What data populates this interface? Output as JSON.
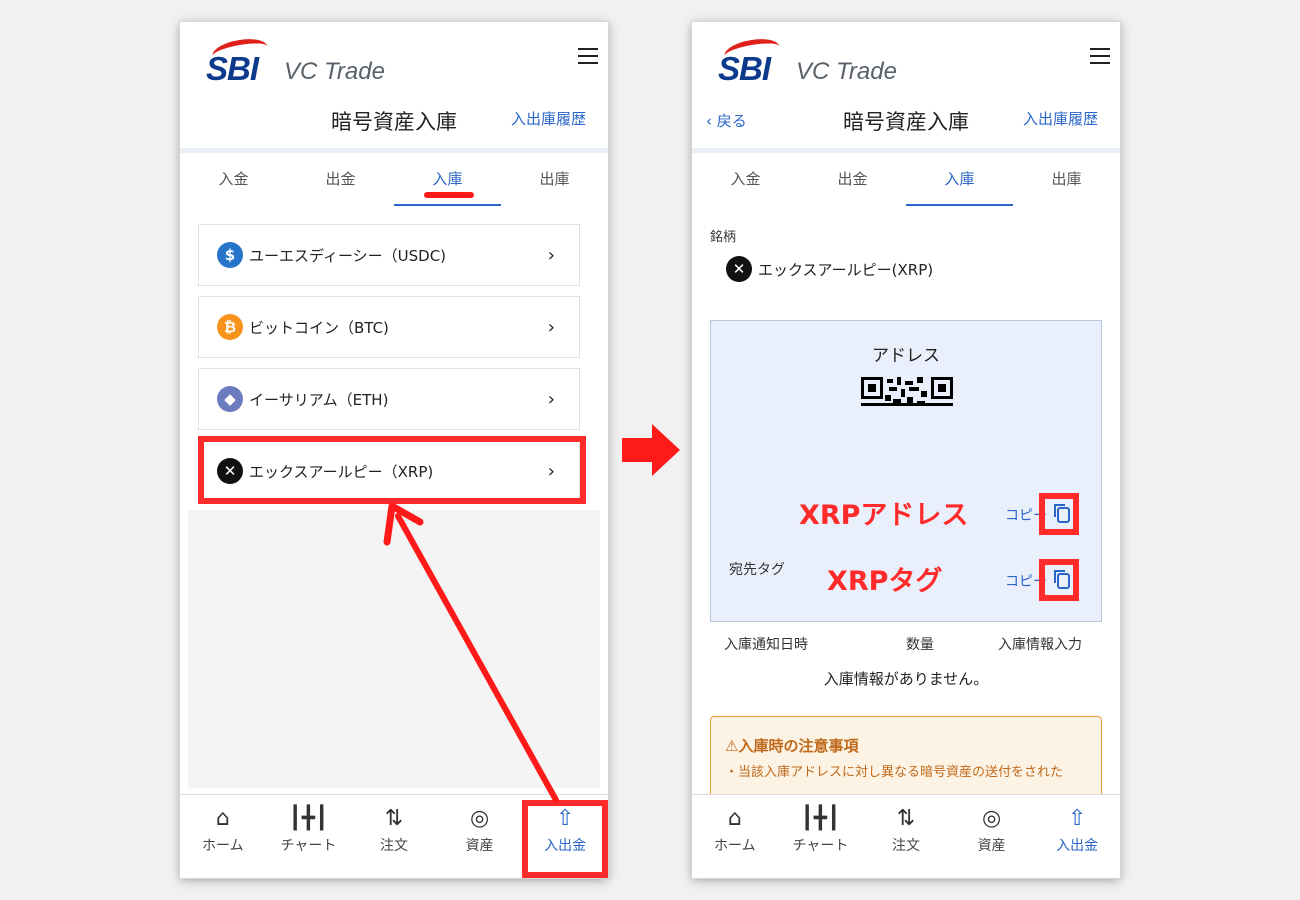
{
  "brand": {
    "sbi": "SBI",
    "vc_trade": "VC Trade"
  },
  "left": {
    "title": "暗号資産入庫",
    "history_link": "入出庫履歴",
    "tabs": [
      "入金",
      "出金",
      "入庫",
      "出庫"
    ],
    "active_tab": "入庫",
    "coins": [
      {
        "label": "ユーエスディーシー（USDC)",
        "icon": "usdc-icon",
        "color": "#2775ca",
        "glyph": "$"
      },
      {
        "label": "ビットコイン（BTC)",
        "icon": "bitcoin-icon",
        "color": "#f7931a",
        "glyph": "₿"
      },
      {
        "label": "イーサリアム（ETH)",
        "icon": "ethereum-icon",
        "color": "#6c7cbf",
        "glyph": "◆"
      },
      {
        "label": "エックスアールピー（XRP)",
        "icon": "xrp-icon",
        "color": "#111111",
        "glyph": "✕"
      }
    ]
  },
  "right": {
    "back": "‹ 戻る",
    "title": "暗号資産入庫",
    "history_link": "入出庫履歴",
    "tabs": [
      "入金",
      "出金",
      "入庫",
      "出庫"
    ],
    "active_tab": "入庫",
    "symbol_label": "銘柄",
    "symbol_value": "エックスアールピー(XRP)",
    "address_title": "アドレス",
    "address_value": "XRPアドレス",
    "copy": "コピー",
    "tag_label": "宛先タグ",
    "tag_value": "XRPタグ",
    "history_cols": [
      "入庫通知日時",
      "数量",
      "入庫情報入力"
    ],
    "no_info": "入庫情報がありません。",
    "notice_title": "⚠入庫時の注意事項",
    "notice_body": "・当該入庫アドレスに対し異なる暗号資産の送付をされた"
  },
  "nav": [
    {
      "label": "ホーム",
      "icon": "home-icon"
    },
    {
      "label": "チャート",
      "icon": "chart-icon"
    },
    {
      "label": "注文",
      "icon": "order-icon"
    },
    {
      "label": "資産",
      "icon": "assets-icon"
    },
    {
      "label": "入出金",
      "icon": "deposit-withdraw-icon"
    }
  ],
  "nav_active": "入出金",
  "colors": {
    "accent": "#2a66c7",
    "highlight": "#ff2a2a",
    "panel": "#eaf0fb",
    "notice": "#fdf3e4"
  }
}
